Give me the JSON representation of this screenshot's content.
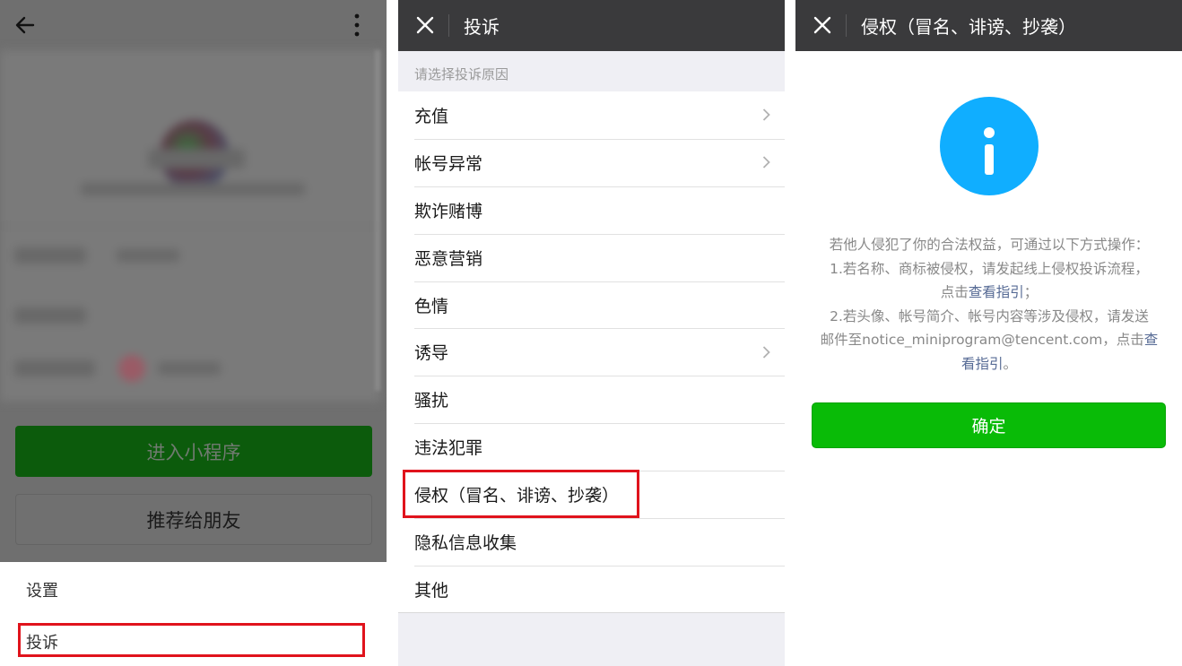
{
  "panel1": {
    "enter_button": "进入小程序",
    "share_button": "推荐给朋友",
    "sheet": {
      "settings": "设置",
      "complaint": "投诉"
    }
  },
  "panel2": {
    "title": "投诉",
    "section_label": "请选择投诉原因",
    "reasons": [
      "充值",
      "帐号异常",
      "欺诈赌博",
      "恶意营销",
      "色情",
      "诱导",
      "骚扰",
      "违法犯罪",
      "侵权（冒名、诽谤、抄袭）",
      "隐私信息收集",
      "其他"
    ]
  },
  "panel3": {
    "title": "侵权（冒名、诽谤、抄袭）",
    "desc": {
      "l1": "若他人侵犯了你的合法权益，可通过以下方式操作：",
      "l2": "1.若名称、商标被侵权，请发起线上侵权投诉流程，",
      "l3_pre": "点击",
      "l3_link": "查看指引",
      "l3_post": "；",
      "l4": "2.若头像、帐号简介、帐号内容等涉及侵权，请发送",
      "l5_pre": "邮件至notice_miniprogram@tencent.com，点击",
      "l5_link": "查",
      "l6_link": "看指引",
      "l6_post": "。"
    },
    "ok_button": "确定"
  },
  "colors": {
    "navbar": "#3a3a3c",
    "highlight_box": "#e0131c",
    "info_blue": "#10aeff",
    "confirm_green": "#09bb07",
    "link_blue": "#576b95"
  }
}
